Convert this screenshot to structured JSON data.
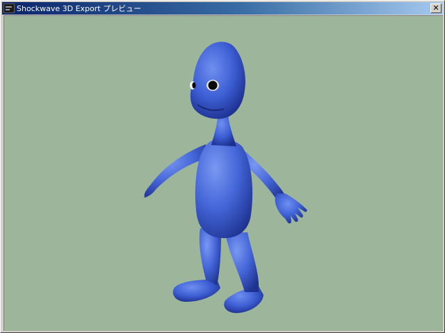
{
  "window": {
    "title": "Shockwave 3D Export プレビュー",
    "app_icon": "shockwave-3d-app-icon",
    "close_label": "✕",
    "close_icon": "close-icon"
  },
  "viewport": {
    "background_color": "#9cb59b",
    "model_color": "#3d5fd4",
    "model": "3d-blue-alien-character-model"
  }
}
